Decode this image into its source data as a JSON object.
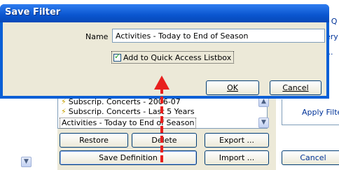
{
  "dialog": {
    "title": "Save Filter",
    "name_label": "Name",
    "name_value": "Activities - Today to End of Season",
    "checkbox_label": "Add to Quick Access Listbox",
    "checkbox_checked": true,
    "ok_label": "OK",
    "cancel_label": "Cancel"
  },
  "background": {
    "list_items": [
      "Subscrip. Concerts - 2006-07",
      "Subscrip. Concerts - Last 5 Years",
      "Activities - Today to End of Season"
    ],
    "restore_label": "Restore",
    "delete_label": "Delete",
    "export_label": "Export ...",
    "save_definition_label": "Save Definition",
    "import_label": "Import ...",
    "apply_filter_label": "Apply Filte",
    "cancel_label": "Cancel",
    "right_edge_texts": [
      "t Q",
      "ery",
      "..."
    ]
  },
  "colors": {
    "titlebar": "#0a55cf",
    "dialog_bg": "#ece9d8",
    "arrow": "#e8201e",
    "link_blue": "#003399"
  }
}
